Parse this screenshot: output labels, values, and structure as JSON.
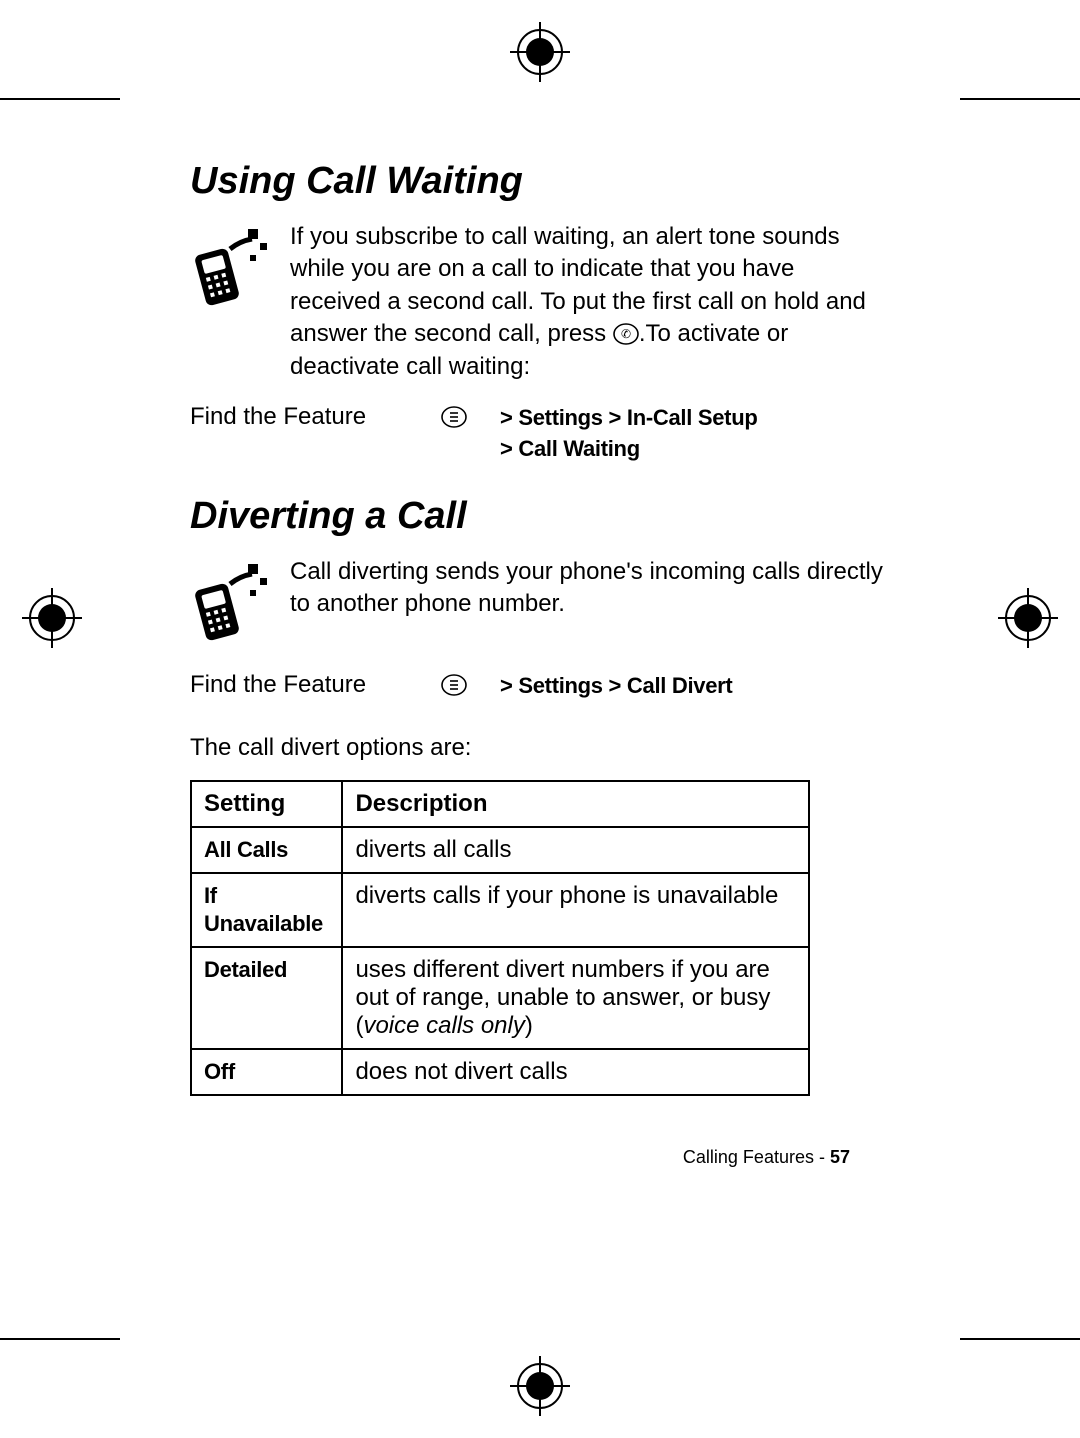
{
  "section1": {
    "heading": "Using Call Waiting",
    "paragraph_pre": "If you subscribe to call waiting, an alert tone sounds while you are on a call to indicate that you have received a second call. To put the first call on hold and answer the second call, press ",
    "paragraph_post": ".To activate or deactivate call waiting:",
    "find_label": "Find the Feature",
    "path_line1": "> Settings > In-Call Setup",
    "path_line2": "> Call Waiting"
  },
  "section2": {
    "heading": "Diverting a Call",
    "paragraph": "Call diverting sends your phone's incoming calls directly to another phone number.",
    "find_label": "Find the Feature",
    "path_line1": "> Settings > Call Divert",
    "options_intro": "The call divert options are:"
  },
  "table": {
    "headers": {
      "col1": "Setting",
      "col2": "Description"
    },
    "rows": [
      {
        "setting": "All Calls",
        "desc": "diverts all calls"
      },
      {
        "setting": "If Unavailable",
        "desc": "diverts calls if your phone is unavailable"
      },
      {
        "setting": "Detailed",
        "desc_pre": "uses different divert numbers if you are out of range, unable to answer, or busy (",
        "desc_italic": "voice calls only",
        "desc_post": ")"
      },
      {
        "setting": "Off",
        "desc": "does not divert calls"
      }
    ]
  },
  "footer": {
    "label": "Calling Features - ",
    "page": "57"
  },
  "icons": {
    "phone_network": "phone-network-icon",
    "send_key": "send-key-icon",
    "menu_key": "menu-key-icon",
    "registration": "registration-mark-icon"
  }
}
